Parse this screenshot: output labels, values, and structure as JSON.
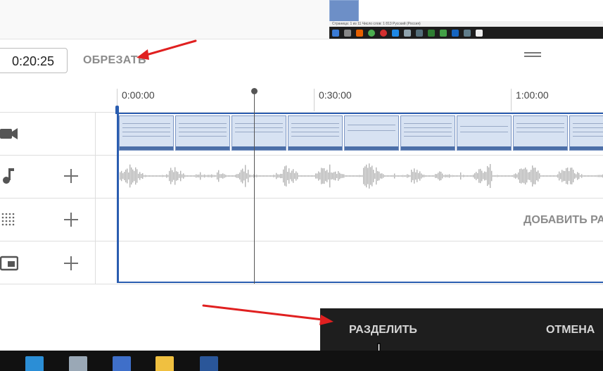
{
  "header": {
    "time_value": "0:20:25",
    "trim_label": "ОБРЕЗАТЬ"
  },
  "preview": {
    "statusbar_text": "Страница: 1 из 11   Число слов: 1 813   Русский (Россия)"
  },
  "ruler": {
    "labels": [
      "0:00:00",
      "0:30:00",
      "1:00:00"
    ]
  },
  "tracks": {
    "text_track_prompt": "ДОБАВИТЬ РА"
  },
  "split_bar": {
    "split_label": "РАЗДЕЛИТЬ",
    "cancel_label": "ОТМЕНА"
  },
  "colors": {
    "accent": "#2a5db0",
    "annotation_arrow": "#e02020",
    "split_bar_bg": "#1e1e1e"
  },
  "icons": [
    "video-camera-icon",
    "music-note-icon",
    "dots-grid-icon",
    "picture-in-picture-icon",
    "plus-icon",
    "hamburger-menu-icon",
    "mouse-pointer-icon"
  ]
}
